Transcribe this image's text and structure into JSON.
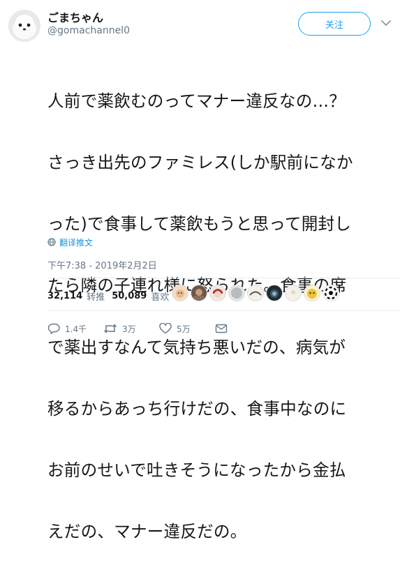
{
  "tweet": {
    "display_name": "ごまちゃん",
    "handle": "@gomachannel0",
    "follow_label": "关注",
    "text_lines": [
      "人前で薬飲むのってマナー違反なの…？",
      "さっき出先のファミレス(しか駅前になか",
      "った)で食事して薬飲もうと思って開封し",
      "たら隣の子連れ様に怒られた。食事の席",
      "で薬出すなんて気持ち悪いだの、病気が",
      "移るからあっち行けだの、食事中なのに",
      "お前のせいで吐きそうになったから金払",
      "えだの、マナー違反だの。"
    ],
    "translate_label": "翻译推文",
    "timestamp": "下午7:38 - 2019年2月2日"
  },
  "stats": {
    "retweets": "32,114",
    "retweets_label": "转推",
    "likes": "50,089",
    "likes_label": "喜欢"
  },
  "likers": [
    "avatar-1",
    "avatar-2",
    "avatar-3",
    "avatar-4",
    "avatar-5",
    "avatar-6",
    "avatar-7",
    "avatar-8",
    "avatar-9"
  ],
  "actions": {
    "reply_count": "1.4千",
    "retweet_count": "3万",
    "like_count": "5万"
  },
  "colors": {
    "accent": "#1da1f2",
    "secondary_text": "#657786",
    "divider": "#e6ecf0"
  }
}
